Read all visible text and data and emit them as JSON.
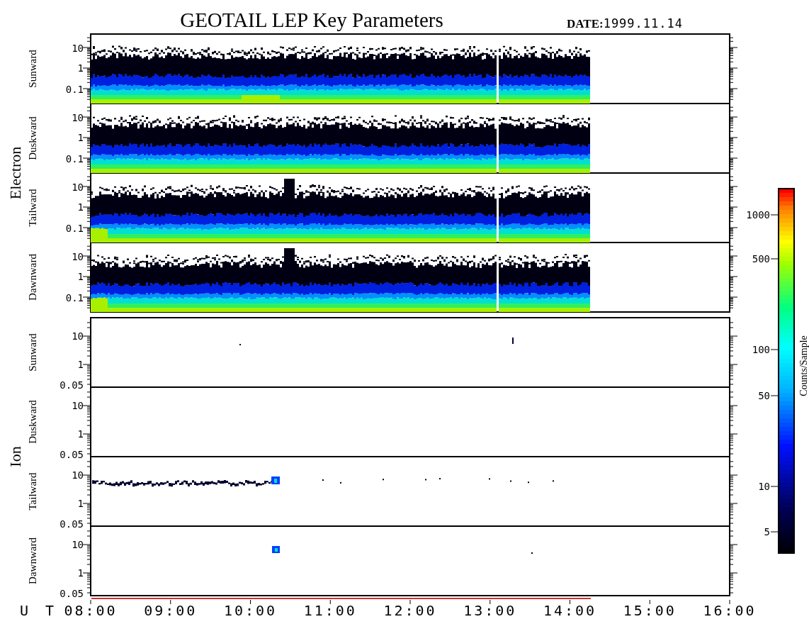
{
  "title": "GEOTAIL LEP Key Parameters",
  "date": {
    "label": "DATE:",
    "value": "1999.11.14"
  },
  "groups": [
    {
      "name": "Electron",
      "kind": "electron",
      "panels": [
        {
          "direction": "Sunward",
          "yticks": [
            "10",
            "1",
            "0.1"
          ]
        },
        {
          "direction": "Duskward",
          "yticks": [
            "10",
            "1",
            "0.1"
          ]
        },
        {
          "direction": "Tailward",
          "yticks": [
            "10",
            "1",
            "0.1"
          ]
        },
        {
          "direction": "Dawnward",
          "yticks": [
            "10",
            "1",
            "0.1"
          ]
        }
      ]
    },
    {
      "name": "Ion",
      "kind": "ion",
      "panels": [
        {
          "direction": "Sunward",
          "yticks": [
            "10",
            "1",
            "0.05"
          ]
        },
        {
          "direction": "Duskward",
          "yticks": [
            "10",
            "1",
            "0.05"
          ]
        },
        {
          "direction": "Tailward",
          "yticks": [
            "10",
            "1",
            "0.05"
          ]
        },
        {
          "direction": "Dawnward",
          "yticks": [
            "10",
            "1",
            "0.05"
          ]
        }
      ]
    }
  ],
  "x_axis": {
    "label": "U T",
    "ticks": [
      "08:00",
      "09:00",
      "10:00",
      "11:00",
      "12:00",
      "13:00",
      "14:00",
      "15:00",
      "16:00"
    ]
  },
  "colorbar": {
    "label": "Counts/Sample",
    "ticks": [
      "1000",
      "500",
      "100",
      "50",
      "10",
      "5"
    ]
  }
}
